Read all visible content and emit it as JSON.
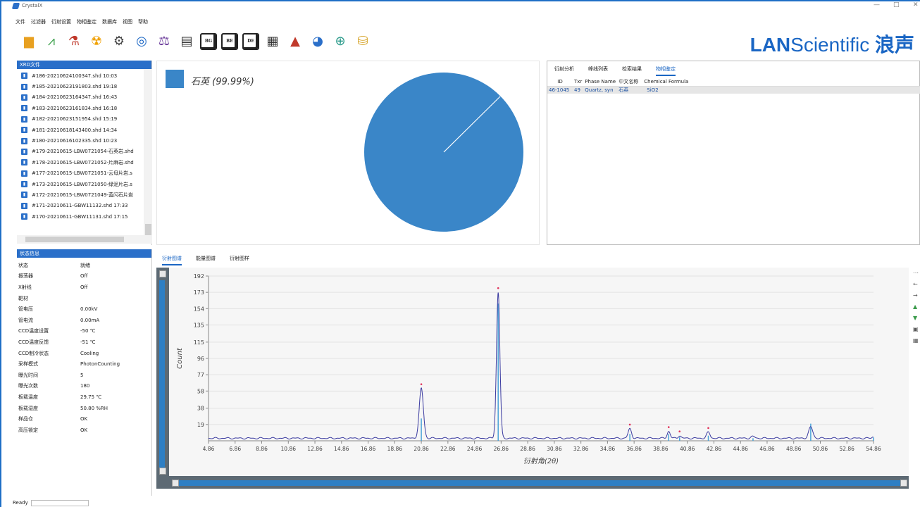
{
  "window": {
    "title": "CrystalX",
    "minimize": "—",
    "restore": "□",
    "close": "✕"
  },
  "menu": [
    "文件",
    "过滤器",
    "衍射设置",
    "物相鉴定",
    "数据库",
    "视图",
    "帮助"
  ],
  "toolbar": {
    "icons": [
      "folder-icon",
      "chart-icon",
      "flask-icon",
      "radiation-icon",
      "gear-icon",
      "fingerprint-icon",
      "scale-icon",
      "report-icon",
      "bg-icon",
      "be-icon",
      "de-icon",
      "waveform-icon",
      "mountain-icon",
      "pie-icon",
      "search-chart-icon",
      "database-gear-icon"
    ],
    "box_labels": {
      "bg": "BG",
      "be": "BE",
      "de": "DE"
    }
  },
  "brand": {
    "bold": "LAN",
    "light": "Scientific",
    "cn": "浪声"
  },
  "files_panel": {
    "title": "XRD文件",
    "items": [
      "#186-20210624100347.shd 10:03",
      "#185-20210623191803.shd 19:18",
      "#184-20210623164347.shd 16:43",
      "#183-20210623161834.shd 16:18",
      "#182-20210623151954.shd 15:19",
      "#181-20210618143400.shd 14:34",
      "#180-20210616102335.shd 10:23",
      "#179-20210615-LBW0721054-石英岩.shd",
      "#178-20210615-LBW0721052-片麻岩.shd",
      "#177-20210615-LBW0721051-云母片岩.s",
      "#173-20210615-LBW0721050-绿泥片岩.s",
      "#172-20210615-LBW0721049-蓝闪石片岩",
      "#171-20210611-GBW11132.shd 17:33",
      "#170-20210611-GBW11131.shd 17:15"
    ]
  },
  "status_panel": {
    "title": "状态信息",
    "rows": [
      {
        "k": "状态",
        "v": "就绪"
      },
      {
        "k": "振荡器",
        "v": "Off"
      },
      {
        "k": "X射线",
        "v": "Off"
      },
      {
        "k": "靶材",
        "v": ""
      },
      {
        "k": "管电压",
        "v": "0.00kV"
      },
      {
        "k": "管电流",
        "v": "0.00mA"
      },
      {
        "k": "CCD温度设置",
        "v": "-50 ℃"
      },
      {
        "k": "CCD温度反馈",
        "v": "-51 ℃"
      },
      {
        "k": "CCD制冷状态",
        "v": "Cooling"
      },
      {
        "k": "采样模式",
        "v": "PhotonCounting"
      },
      {
        "k": "曝光时间",
        "v": "5"
      },
      {
        "k": "曝光次数",
        "v": "180"
      },
      {
        "k": "板载温度",
        "v": "29.75 ℃"
      },
      {
        "k": "板载湿度",
        "v": "50.80 %RH"
      },
      {
        "k": "样品仓",
        "v": "OK"
      },
      {
        "k": "高压锁定",
        "v": "OK"
      }
    ]
  },
  "pie": {
    "legend": "石英 (99.99%)",
    "color": "#3a86c8",
    "slices": [
      {
        "name": "石英",
        "percent": 99.99
      }
    ]
  },
  "phase_panel": {
    "tabs": [
      "衍射分析",
      "峰线列表",
      "检索结果",
      "物相鉴定"
    ],
    "active_tab": 3,
    "columns": [
      "ID",
      "Txr",
      "Phase Name",
      "中文名称",
      "Chemical Formula"
    ],
    "rows": [
      [
        "46-1045",
        "49",
        "Quartz, syn",
        "石英",
        "SiO2"
      ]
    ]
  },
  "spectrum": {
    "tabs": [
      "衍射图谱",
      "能量图谱",
      "衍射图样"
    ],
    "active_tab": 0
  },
  "statusbar": {
    "text": "Ready"
  },
  "chart_data": {
    "type": "line",
    "xlabel": "衍射角(2θ)",
    "ylabel": "Count",
    "xlim": [
      4.86,
      54.86
    ],
    "ylim": [
      0,
      192
    ],
    "xticks": [
      4.86,
      6.86,
      8.86,
      10.86,
      12.86,
      14.86,
      16.86,
      18.86,
      20.86,
      22.86,
      24.86,
      26.86,
      28.86,
      30.86,
      32.86,
      34.86,
      36.86,
      38.86,
      40.86,
      42.86,
      44.86,
      46.86,
      48.86,
      50.86,
      52.86,
      54.86
    ],
    "yticks": [
      19,
      38,
      58,
      77,
      96,
      115,
      135,
      154,
      173,
      192
    ],
    "line_color": "#3a3aa0",
    "peak_color": "#4aa3d8",
    "marker_color": "#e0325a",
    "baseline": 3,
    "peaks": [
      {
        "x": 20.86,
        "y": 61,
        "w": 0.22,
        "stick": 26,
        "marked": true
      },
      {
        "x": 26.64,
        "y": 173,
        "w": 0.18,
        "stick": 160,
        "marked": true
      },
      {
        "x": 36.54,
        "y": 14,
        "w": 0.18,
        "stick": 8,
        "marked": true
      },
      {
        "x": 39.46,
        "y": 11,
        "w": 0.16,
        "stick": 8,
        "marked": true
      },
      {
        "x": 40.28,
        "y": 6,
        "w": 0.15,
        "stick": 4,
        "marked": true
      },
      {
        "x": 42.44,
        "y": 10,
        "w": 0.18,
        "stick": 6,
        "marked": true
      },
      {
        "x": 45.8,
        "y": 5,
        "w": 0.2,
        "stick": 3,
        "marked": false
      },
      {
        "x": 50.14,
        "y": 16,
        "w": 0.22,
        "stick": 20,
        "marked": false
      },
      {
        "x": 54.86,
        "y": 5,
        "w": 0.12,
        "stick": 4,
        "marked": false
      }
    ]
  }
}
